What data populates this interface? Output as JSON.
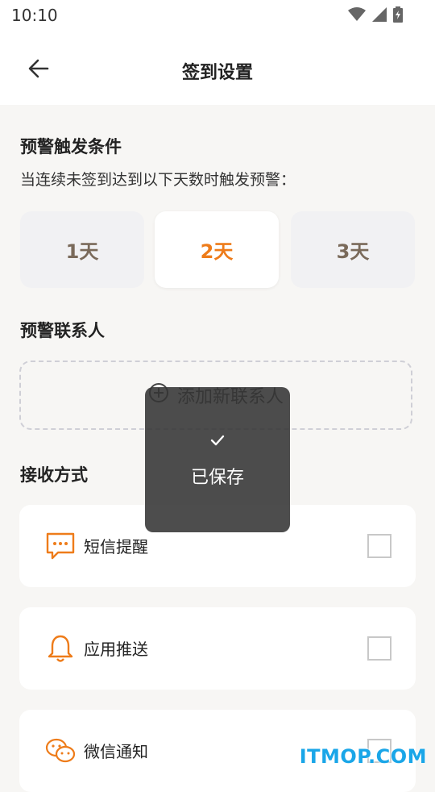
{
  "status_bar": {
    "time": "10:10",
    "icons": [
      "wifi-icon",
      "signal-icon",
      "battery-icon"
    ]
  },
  "header": {
    "title": "签到设置",
    "back_icon": "arrow-left-icon"
  },
  "trigger": {
    "title": "预警触发条件",
    "description": "当连续未签到达到以下天数时触发预警：",
    "options": [
      "1天",
      "2天",
      "3天"
    ],
    "selected": "2天"
  },
  "contacts": {
    "title": "预警联系人",
    "add_label": "添加新联系人"
  },
  "methods": {
    "title": "接收方式",
    "items": [
      {
        "label": "短信提醒",
        "icon": "sms-icon",
        "checked": false
      },
      {
        "label": "应用推送",
        "icon": "bell-icon",
        "checked": false
      },
      {
        "label": "微信通知",
        "icon": "wechat-icon",
        "checked": false
      }
    ]
  },
  "toast": {
    "text": "已保存",
    "icon": "check-icon"
  },
  "watermark": "ITMOP.COM",
  "colors": {
    "accent": "#ee7c1a",
    "background": "#f7f6f4",
    "unselected_text": "#7a6a5a"
  }
}
